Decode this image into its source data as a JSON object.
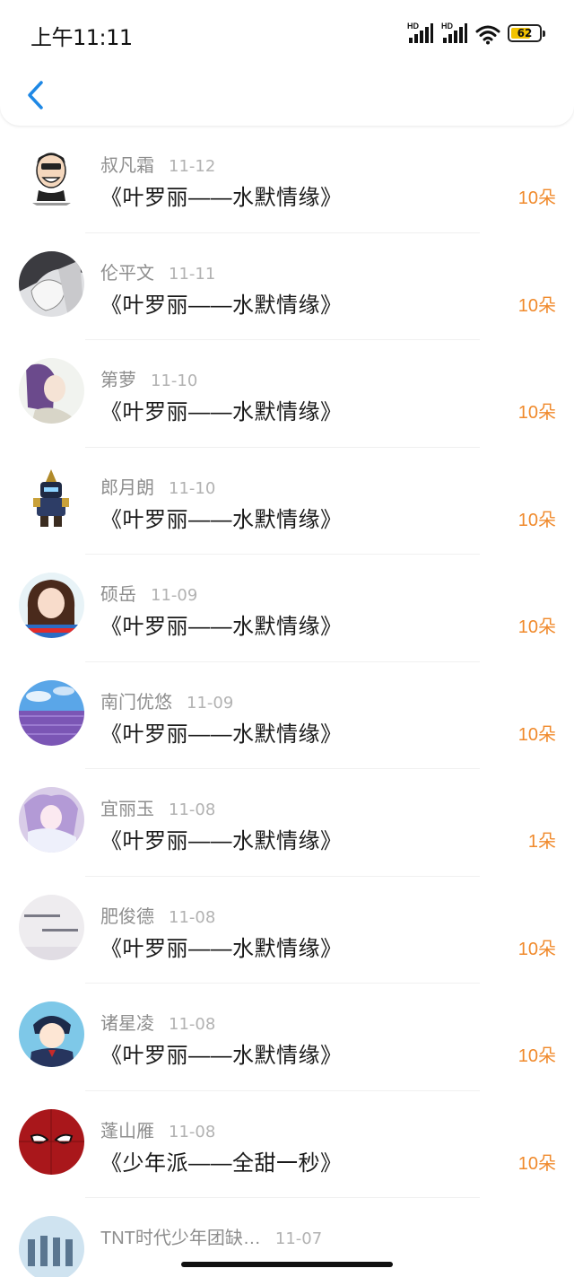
{
  "status_bar": {
    "time": "上午11:11",
    "signal1_label": "HD",
    "signal2_label": "HD",
    "battery_level": "62",
    "icons": [
      "signal-hd-icon",
      "signal-hd-icon",
      "wifi-icon",
      "battery-icon"
    ]
  },
  "nav": {
    "back_icon": "chevron-left-icon",
    "accent": "#1e88e5"
  },
  "colors": {
    "amount": "#f08a2c",
    "name": "#8e8e8e",
    "song": "#1a1a1a"
  },
  "records": [
    {
      "name": "叔凡霜",
      "date": "11-12",
      "song": "《叶罗丽——水默情缘》",
      "amount": "10朵"
    },
    {
      "name": "伦平文",
      "date": "11-11",
      "song": "《叶罗丽——水默情缘》",
      "amount": "10朵"
    },
    {
      "name": "第萝",
      "date": "11-10",
      "song": "《叶罗丽——水默情缘》",
      "amount": "10朵"
    },
    {
      "name": "郎月朗",
      "date": "11-10",
      "song": "《叶罗丽——水默情缘》",
      "amount": "10朵"
    },
    {
      "name": "硕岳",
      "date": "11-09",
      "song": "《叶罗丽——水默情缘》",
      "amount": "10朵"
    },
    {
      "name": "南门优悠",
      "date": "11-09",
      "song": "《叶罗丽——水默情缘》",
      "amount": "10朵"
    },
    {
      "name": "宜丽玉",
      "date": "11-08",
      "song": "《叶罗丽——水默情缘》",
      "amount": "1朵"
    },
    {
      "name": "肥俊德",
      "date": "11-08",
      "song": "《叶罗丽——水默情缘》",
      "amount": "10朵"
    },
    {
      "name": "诸星凌",
      "date": "11-08",
      "song": "《叶罗丽——水默情缘》",
      "amount": "10朵"
    },
    {
      "name": "蓬山雁",
      "date": "11-08",
      "song": "《少年派——全甜一秒》",
      "amount": "10朵"
    },
    {
      "name": "TNT时代少年团缺…",
      "date": "11-07",
      "song": "",
      "amount": ""
    }
  ]
}
